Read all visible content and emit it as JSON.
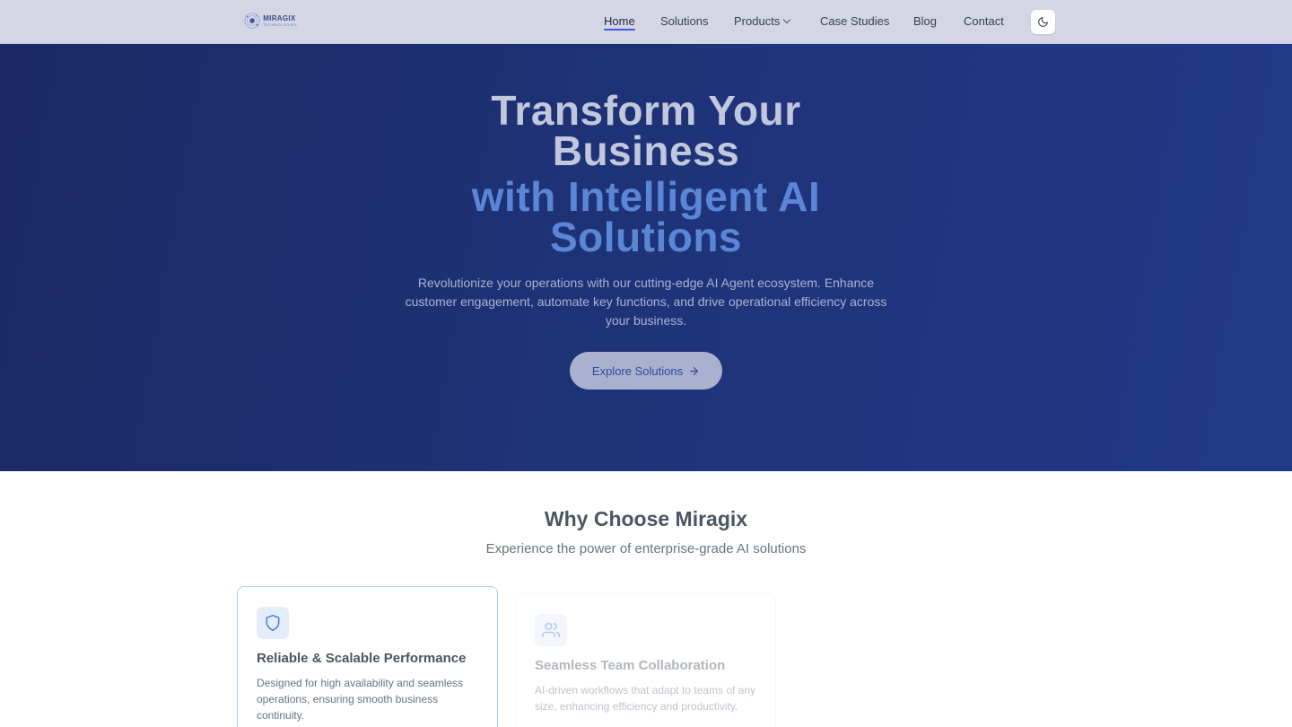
{
  "header": {
    "logo": {
      "name": "MIRAGIX",
      "tagline": "TECHNOLOGIES"
    },
    "nav": [
      {
        "label": "Home",
        "active": true
      },
      {
        "label": "Solutions",
        "active": false
      },
      {
        "label": "Products",
        "active": false,
        "dropdown": true
      },
      {
        "label": "Case Studies",
        "active": false
      },
      {
        "label": "Blog",
        "active": false
      },
      {
        "label": "Contact",
        "active": false
      }
    ],
    "theme_toggle_icon": "moon-icon"
  },
  "hero": {
    "title_line1": "Transform Your Business",
    "title_line2": "with Intelligent AI Solutions",
    "description": "Revolutionize your operations with our cutting-edge AI Agent ecosystem. Enhance customer engagement, automate key functions, and drive operational efficiency across your business.",
    "cta_label": "Explore Solutions",
    "cta_icon": "arrow-right-icon"
  },
  "why": {
    "title": "Why Choose Miragix",
    "subtitle": "Experience the power of enterprise-grade AI solutions",
    "cards": [
      {
        "icon": "shield-icon",
        "title": "Reliable & Scalable Performance",
        "text": "Designed for high availability and seamless operations, ensuring smooth business continuity."
      },
      {
        "icon": "users-icon",
        "title": "Seamless Team Collaboration",
        "text": "AI-driven workflows that adapt to teams of any size, enhancing efficiency and productivity."
      }
    ]
  },
  "colors": {
    "accent": "#3b5bdb",
    "hero_highlight": "#5b86d6",
    "hero_bg": "#1e3276"
  }
}
